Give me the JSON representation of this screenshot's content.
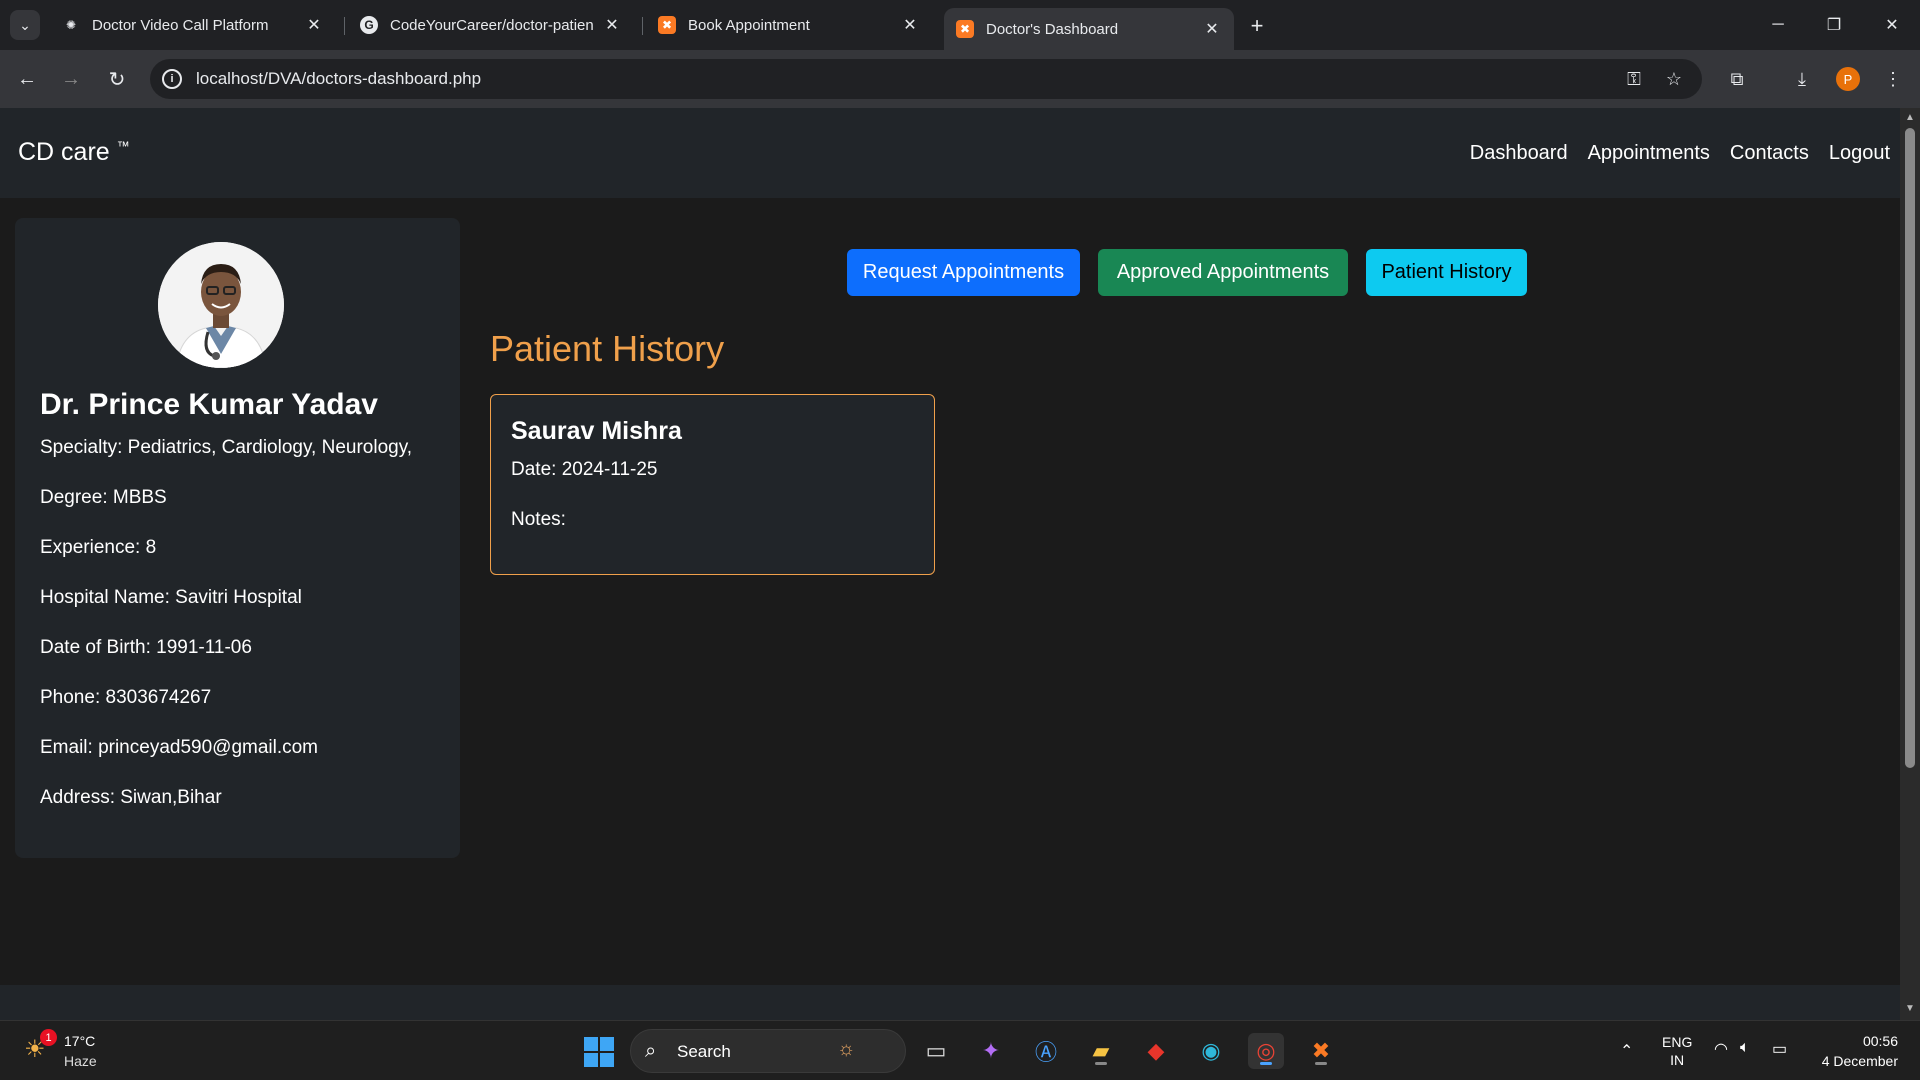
{
  "browser": {
    "tabs": [
      {
        "title": "Doctor Video Call Platform",
        "favicon": "openai-icon"
      },
      {
        "title": "CodeYourCareer/doctor-patien",
        "favicon": "github-icon"
      },
      {
        "title": "Book Appointment",
        "favicon": "xampp-icon"
      },
      {
        "title": "Doctor's Dashboard",
        "favicon": "xampp-icon"
      }
    ],
    "url": "localhost/DVA/doctors-dashboard.php",
    "profile_initial": "P"
  },
  "navbar": {
    "brand": "CD care",
    "brand_tm": "™",
    "links": [
      "Dashboard",
      "Appointments",
      "Contacts",
      "Logout"
    ]
  },
  "doctor": {
    "name": "Dr. Prince Kumar Yadav",
    "specialty": "Specialty: Pediatrics, Cardiology, Neurology,",
    "degree": "Degree: MBBS",
    "experience": "Experience: 8",
    "hospital": "Hospital Name: Savitri Hospital",
    "dob": "Date of Birth: 1991-11-06",
    "phone": "Phone: 8303674267",
    "email": "Email: princeyad590@gmail.com",
    "address": "Address: Siwan,Bihar"
  },
  "actions": {
    "request": "Request Appointments",
    "approved": "Approved Appointments",
    "history": "Patient History"
  },
  "history": {
    "title": "Patient History",
    "records": [
      {
        "patient": "Saurav Mishra",
        "date": "Date: 2024-11-25",
        "notes": "Notes:"
      }
    ]
  },
  "taskbar": {
    "weather_temp": "17°C",
    "weather_desc": "Haze",
    "weather_badge": "1",
    "search_placeholder": "Search",
    "lang_top": "ENG",
    "lang_bottom": "IN",
    "time": "00:56",
    "date": "4 December"
  },
  "colors": {
    "accent_orange": "#f0a04b",
    "primary": "#0d6efd",
    "success": "#198754",
    "info": "#0dcaf0"
  }
}
